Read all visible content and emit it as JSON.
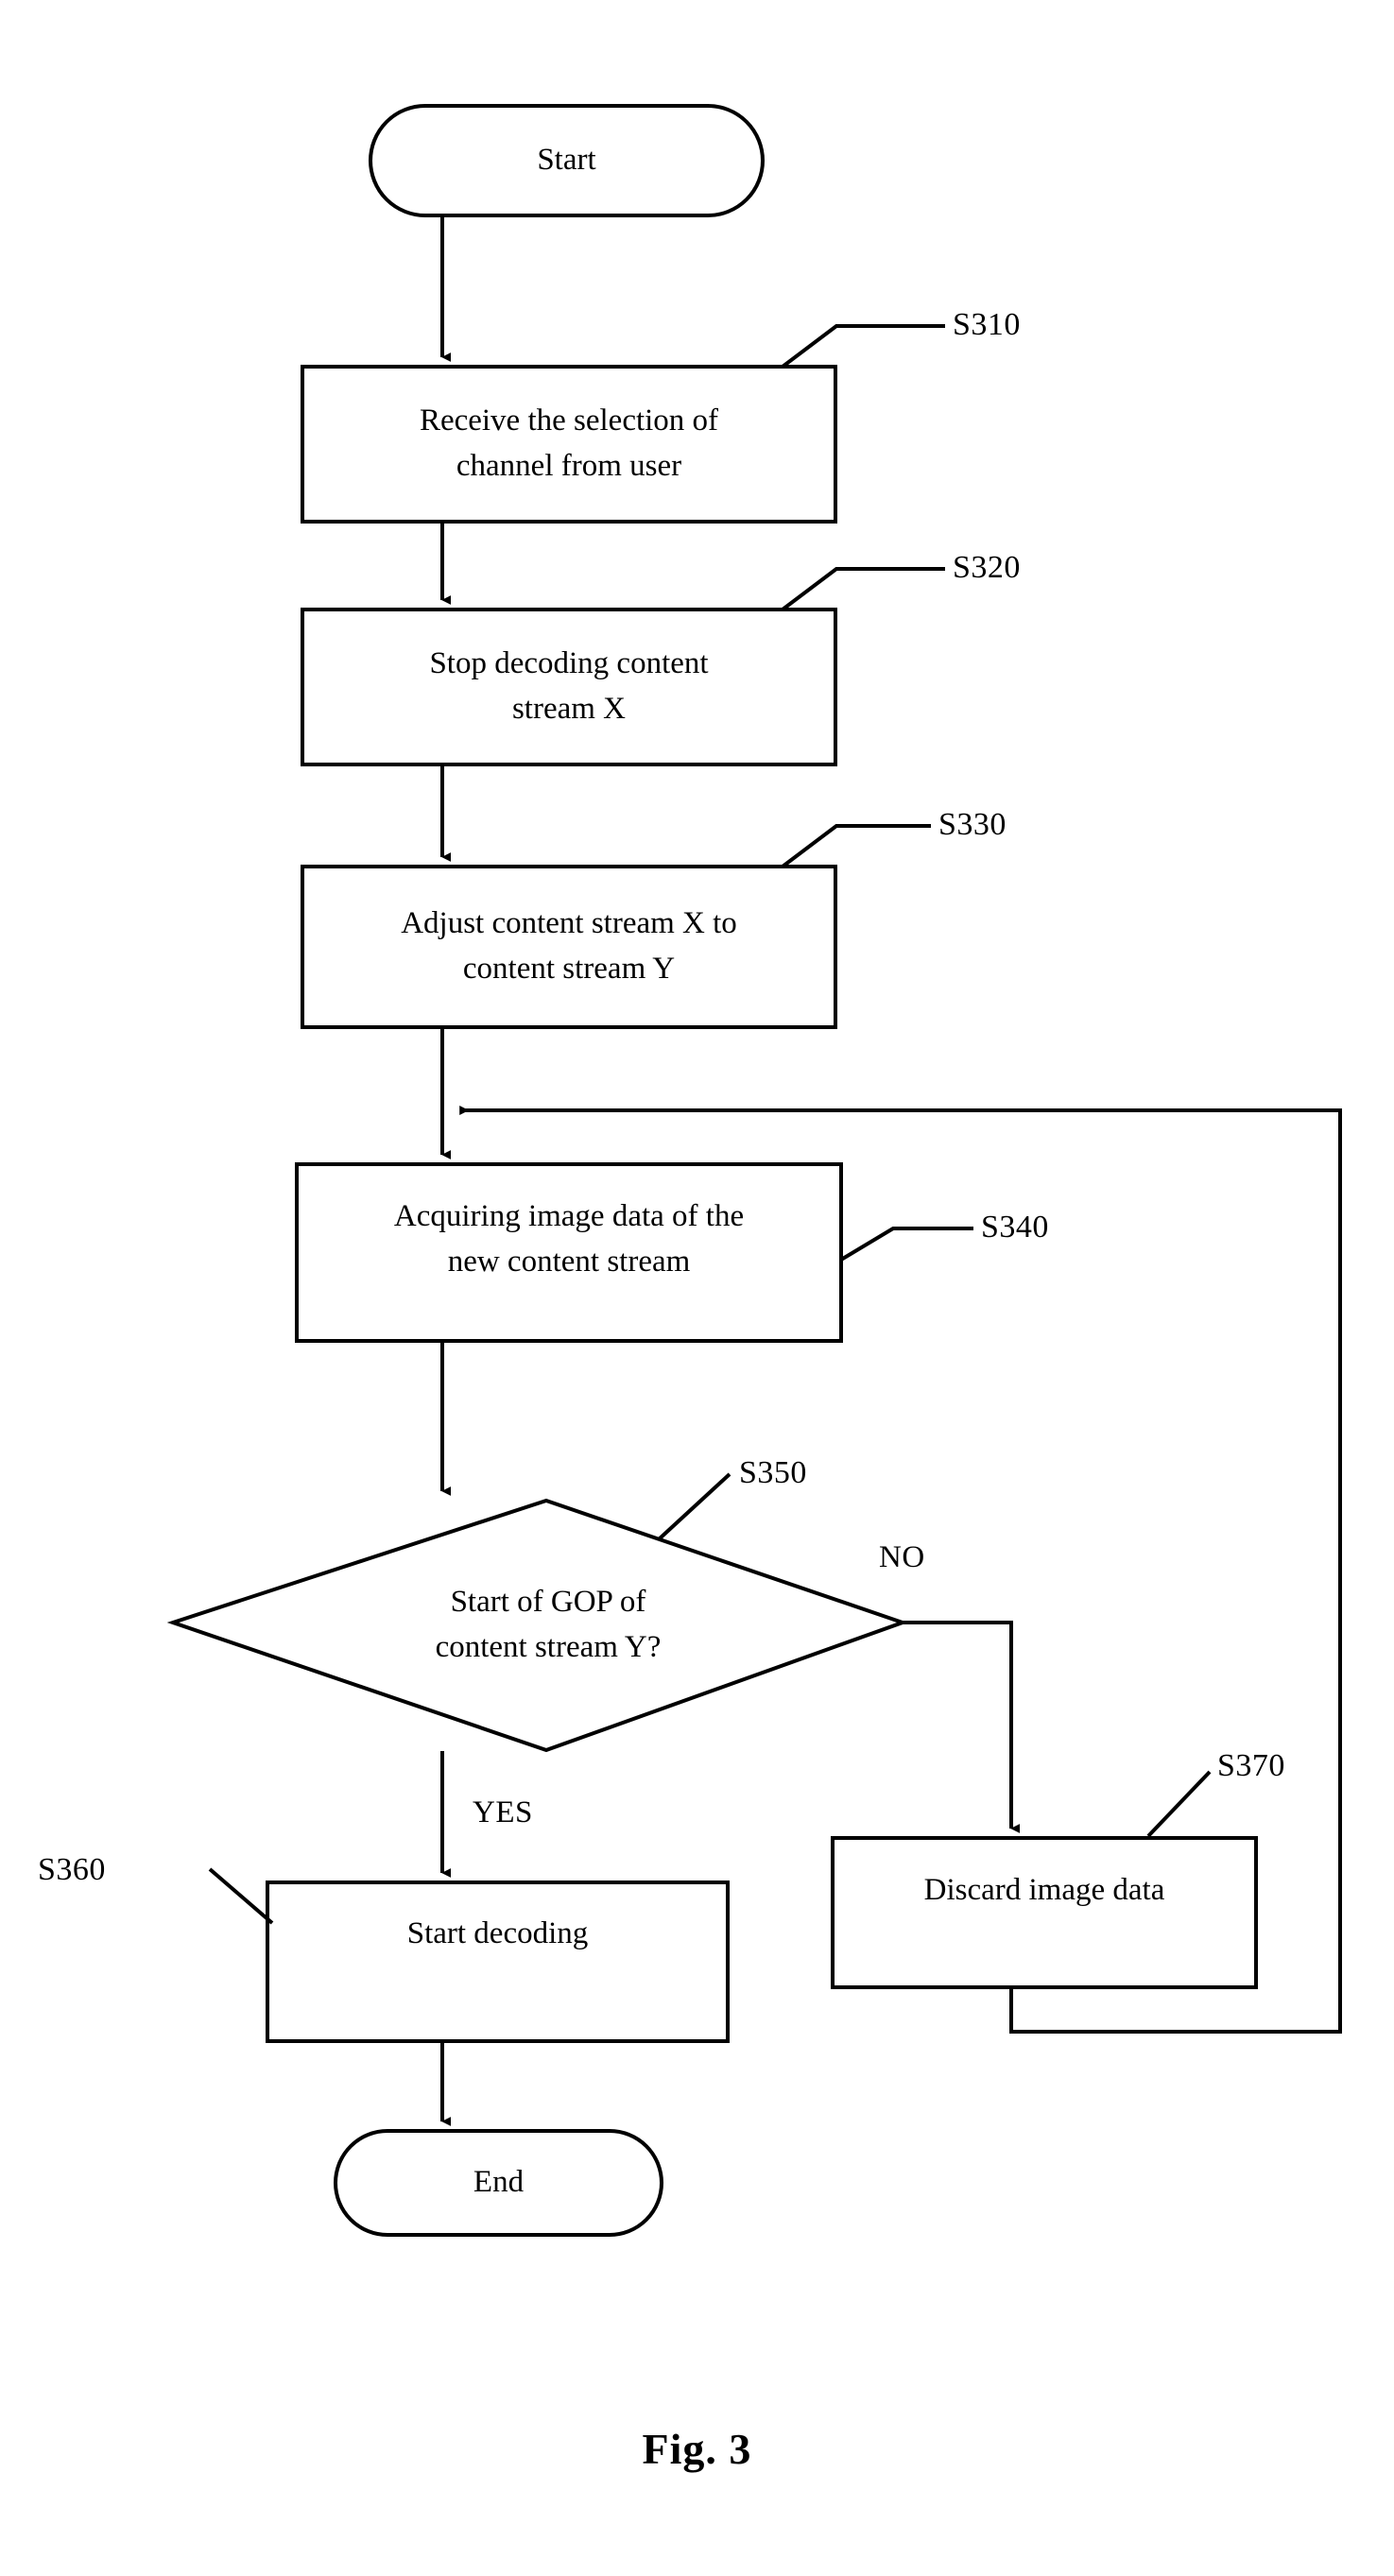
{
  "figure": {
    "caption": "Fig. 3",
    "type": "flowchart"
  },
  "nodes": {
    "start": {
      "shape": "terminator",
      "label": "Start"
    },
    "s310": {
      "shape": "process",
      "tag": "S310",
      "line1": "Receive the selection of",
      "line2": "channel from user"
    },
    "s320": {
      "shape": "process",
      "tag": "S320",
      "line1": "Stop decoding content",
      "line2": "stream X"
    },
    "s330": {
      "shape": "process",
      "tag": "S330",
      "line1": "Adjust content stream X to",
      "line2": "content stream Y"
    },
    "s340": {
      "shape": "process",
      "tag": "S340",
      "line1": "Acquiring image data of the",
      "line2": "new content stream"
    },
    "s350": {
      "shape": "decision",
      "tag": "S350",
      "line1": "Start of GOP of",
      "line2": "content stream Y?"
    },
    "s360": {
      "shape": "process",
      "tag": "S360",
      "line1": "Start decoding"
    },
    "s370": {
      "shape": "process",
      "tag": "S370",
      "line1": "Discard image data"
    },
    "end": {
      "shape": "terminator",
      "label": "End"
    }
  },
  "branch_labels": {
    "yes": "YES",
    "no": "NO"
  },
  "colors": {
    "stroke": "#000000",
    "fill": "#ffffff",
    "text": "#000000"
  }
}
